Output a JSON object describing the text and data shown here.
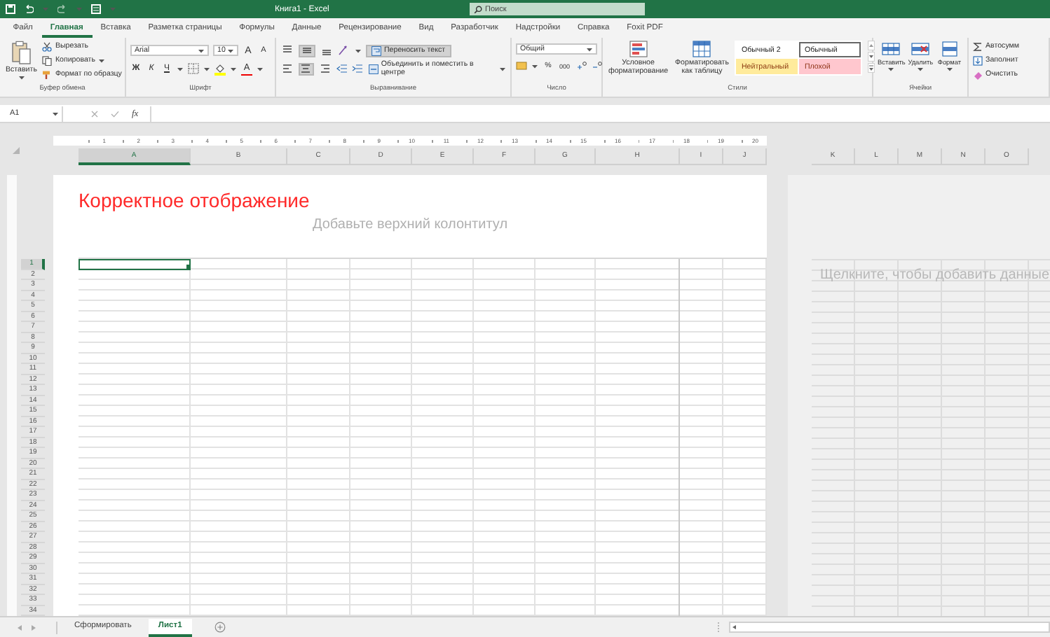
{
  "title_bar": {
    "title": "Книга1 - Excel",
    "search": {
      "placeholder": "Поиск"
    }
  },
  "menu_tabs": [
    {
      "label": "Файл",
      "selected": false
    },
    {
      "label": "Главная",
      "selected": true
    },
    {
      "label": "Вставка",
      "selected": false
    },
    {
      "label": "Разметка страницы",
      "selected": false
    },
    {
      "label": "Формулы",
      "selected": false
    },
    {
      "label": "Данные",
      "selected": false
    },
    {
      "label": "Рецензирование",
      "selected": false
    },
    {
      "label": "Вид",
      "selected": false
    },
    {
      "label": "Разработчик",
      "selected": false
    },
    {
      "label": "Надстройки",
      "selected": false
    },
    {
      "label": "Справка",
      "selected": false
    },
    {
      "label": "Foxit PDF",
      "selected": false
    }
  ],
  "ribbon": {
    "clipboard": {
      "label": "Буфер обмена",
      "paste": "Вставить",
      "cut": "Вырезать",
      "copy": "Копировать",
      "format_painter": "Формат по образцу"
    },
    "font": {
      "label": "Шрифт",
      "font_name": "Arial",
      "font_size": "10",
      "grow": "A",
      "shrink": "A",
      "bold": "Ж",
      "italic": "К",
      "underline": "Ч",
      "font_color": "A"
    },
    "alignment": {
      "label": "Выравнивание",
      "vertical": [
        {
          "on": false
        },
        {
          "on": true
        },
        {
          "on": false
        }
      ],
      "horizontal": [
        {
          "on": false
        },
        {
          "on": true
        },
        {
          "on": false
        }
      ],
      "wrap_text": {
        "label": "Переносить текст",
        "on": true
      },
      "merge": "Объединить и поместить в центре"
    },
    "number": {
      "label": "Число",
      "format": "Общий",
      "percent": "%",
      "thousands": "000"
    },
    "styles": {
      "label": "Стили",
      "conditional": "Условное форматирование",
      "as_table": "Форматировать как таблицу",
      "cell_styles": [
        {
          "name": "Обычный 2",
          "color": "#ffffff",
          "selected": false
        },
        {
          "name": "Обычный",
          "color": "#ffffff",
          "selected": true
        },
        {
          "name": "Нейтральный",
          "color": "#ffeb9c",
          "selected": false
        },
        {
          "name": "Плохой",
          "color": "#ffc7ce",
          "selected": false
        }
      ]
    },
    "cells": {
      "label": "Ячейки",
      "buttons": [
        "Вставить",
        "Удалить",
        "Формат"
      ]
    },
    "editing": {
      "items": [
        "Автосумм",
        "Заполнит",
        "Очистить"
      ]
    }
  },
  "formula_bar": {
    "name_box": "A1",
    "function_symbol": "fx"
  },
  "ruler": [
    "1",
    "2",
    "3",
    "4",
    "5",
    "6",
    "7",
    "8",
    "9",
    "10",
    "11",
    "12",
    "13",
    "14",
    "15",
    "16",
    "17",
    "18",
    "19",
    "20"
  ],
  "columns": [
    {
      "label": "A",
      "selected": true
    },
    {
      "label": "B",
      "selected": false
    },
    {
      "label": "C",
      "selected": false
    },
    {
      "label": "D",
      "selected": false
    },
    {
      "label": "E",
      "selected": false
    },
    {
      "label": "F",
      "selected": false
    },
    {
      "label": "G",
      "selected": false
    },
    {
      "label": "H",
      "selected": false
    },
    {
      "label": "I",
      "selected": false
    },
    {
      "label": "J",
      "selected": false
    }
  ],
  "page2_columns": [
    {
      "label": "K",
      "selected": false
    },
    {
      "label": "L",
      "selected": false
    },
    {
      "label": "M",
      "selected": false
    },
    {
      "label": "N",
      "selected": false
    },
    {
      "label": "O",
      "selected": false
    }
  ],
  "rows": [
    {
      "label": "1",
      "selected": true
    },
    {
      "label": "2",
      "selected": false
    },
    {
      "label": "3",
      "selected": false
    },
    {
      "label": "4",
      "selected": false
    },
    {
      "label": "5",
      "selected": false
    },
    {
      "label": "6",
      "selected": false
    },
    {
      "label": "7",
      "selected": false
    },
    {
      "label": "8",
      "selected": false
    },
    {
      "label": "9",
      "selected": false
    },
    {
      "label": "10",
      "selected": false
    },
    {
      "label": "11",
      "selected": false
    },
    {
      "label": "12",
      "selected": false
    },
    {
      "label": "13",
      "selected": false
    },
    {
      "label": "14",
      "selected": false
    },
    {
      "label": "15",
      "selected": false
    },
    {
      "label": "16",
      "selected": false
    },
    {
      "label": "17",
      "selected": false
    },
    {
      "label": "18",
      "selected": false
    },
    {
      "label": "19",
      "selected": false
    },
    {
      "label": "20",
      "selected": false
    },
    {
      "label": "21",
      "selected": false
    },
    {
      "label": "22",
      "selected": false
    },
    {
      "label": "23",
      "selected": false
    },
    {
      "label": "24",
      "selected": false
    },
    {
      "label": "25",
      "selected": false
    },
    {
      "label": "26",
      "selected": false
    },
    {
      "label": "27",
      "selected": false
    },
    {
      "label": "28",
      "selected": false
    },
    {
      "label": "29",
      "selected": false
    },
    {
      "label": "30",
      "selected": false
    },
    {
      "label": "31",
      "selected": false
    },
    {
      "label": "32",
      "selected": false
    },
    {
      "label": "33",
      "selected": false
    },
    {
      "label": "34",
      "selected": false
    }
  ],
  "page": {
    "header_title": "Корректное отображение",
    "header_placeholder": "Добавьте верхний колонтитул"
  },
  "page2": {
    "placeholder": "Щелкните, чтобы добавить данные"
  },
  "sheet_tabs": [
    {
      "label": "Сформировать",
      "selected": false
    },
    {
      "label": "Лист1",
      "selected": true
    }
  ]
}
